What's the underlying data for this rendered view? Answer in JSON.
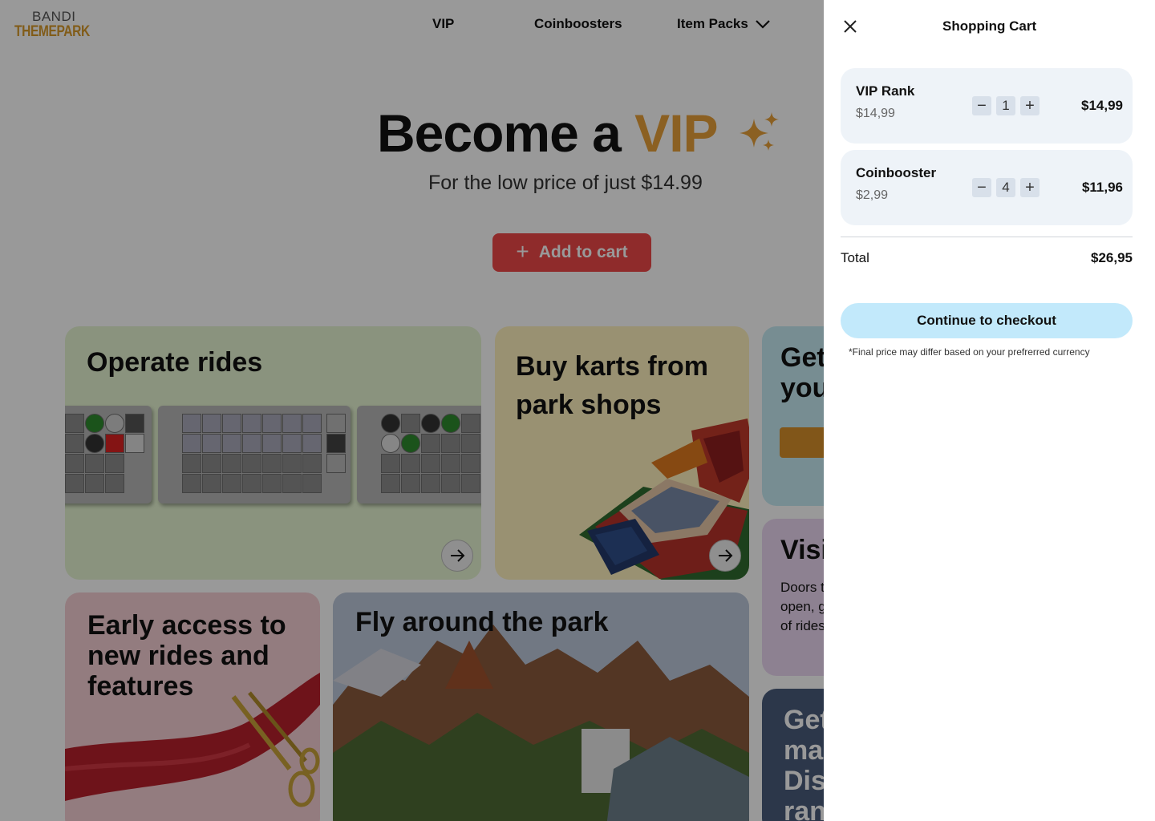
{
  "logo": {
    "line1": "BANDI",
    "line2": "THEMEPARK"
  },
  "nav": {
    "vip": "VIP",
    "coinboosters": "Coinboosters",
    "item_packs": "Item Packs"
  },
  "hero": {
    "title_prefix": "Become a ",
    "title_highlight": "VIP",
    "subtitle": "For the low price of just $14.99",
    "add_to_cart": "Add to cart",
    "add_icon": "+"
  },
  "cards": {
    "rides": "Operate rides",
    "karts": "Buy karts from park shops",
    "get": "Get\nyou",
    "visit_title": "Visi",
    "visit_text": "Doors t\nopen, g\nof rides",
    "early": "Early access to new rides and features",
    "fly": "Fly around the park",
    "discord": "Get\nma\nDis\nran"
  },
  "cart": {
    "title": "Shopping Cart",
    "items": [
      {
        "name": "VIP Rank",
        "price": "$14,99",
        "qty": "1",
        "line_total": "$14,99"
      },
      {
        "name": "Coinbooster",
        "price": "$2,99",
        "qty": "4",
        "line_total": "$11,96"
      }
    ],
    "decrement": "−",
    "increment": "+",
    "total_label": "Total",
    "total_value": "$26,95",
    "checkout_label": "Continue to checkout",
    "note": "*Final price may differ based on your prefrerred currency"
  },
  "colors": {
    "accent_vip": "#e8a13a",
    "add_button": "#ee4848",
    "checkout_button": "#c2e9fb",
    "card_rides": "#e6f5d2",
    "card_karts": "#fff2bf",
    "card_get": "#c6ecf4",
    "card_visit": "#ecd8f2",
    "card_early": "#f6cfd4",
    "card_fly": "#bcc9da",
    "card_discord": "#4a5c7c"
  }
}
